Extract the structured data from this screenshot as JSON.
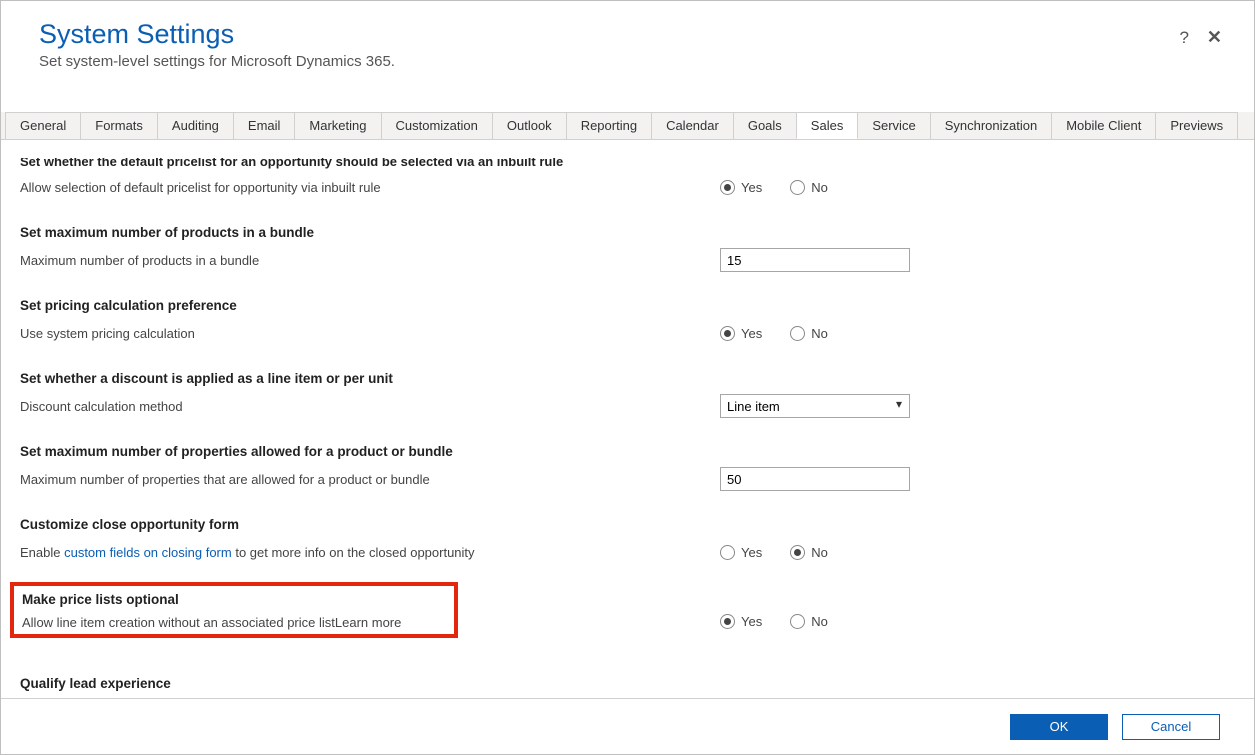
{
  "header": {
    "title": "System Settings",
    "subtitle": "Set system-level settings for Microsoft Dynamics 365."
  },
  "tabs": [
    {
      "label": "General"
    },
    {
      "label": "Formats"
    },
    {
      "label": "Auditing"
    },
    {
      "label": "Email"
    },
    {
      "label": "Marketing"
    },
    {
      "label": "Customization"
    },
    {
      "label": "Outlook"
    },
    {
      "label": "Reporting"
    },
    {
      "label": "Calendar"
    },
    {
      "label": "Goals"
    },
    {
      "label": "Sales",
      "active": true
    },
    {
      "label": "Service"
    },
    {
      "label": "Synchronization"
    },
    {
      "label": "Mobile Client"
    },
    {
      "label": "Previews"
    }
  ],
  "radio_labels": {
    "yes": "Yes",
    "no": "No"
  },
  "cut_heading": "Set whether the default pricelist for an opportunity should be selected via an inbuilt rule",
  "sections": {
    "default_pricelist": {
      "label": "Allow selection of default pricelist for opportunity via inbuilt rule",
      "value": "yes"
    },
    "max_bundle": {
      "heading": "Set maximum number of products in a bundle",
      "label": "Maximum number of products in a bundle",
      "value": "15"
    },
    "pricing_pref": {
      "heading": "Set pricing calculation preference",
      "label": "Use system pricing calculation",
      "value": "yes"
    },
    "discount": {
      "heading": "Set whether a discount is applied as a line item or per unit",
      "label": "Discount calculation method",
      "value": "Line item"
    },
    "max_props": {
      "heading": "Set maximum number of properties allowed for a product or bundle",
      "label": "Maximum number of properties that are allowed for a product or bundle",
      "value": "50"
    },
    "close_opp": {
      "heading": "Customize close opportunity form",
      "label_pre": "Enable ",
      "label_link": "custom fields on closing form",
      "label_post": " to get more info on the closed opportunity",
      "value": "no"
    },
    "price_lists_optional": {
      "heading": "Make price lists optional",
      "label_pre": "Allow line item creation without an associated price list ",
      "label_link": "Learn more",
      "value": "yes"
    },
    "qualify_lead": {
      "heading": "Qualify lead experience"
    }
  },
  "footer": {
    "ok": "OK",
    "cancel": "Cancel"
  }
}
